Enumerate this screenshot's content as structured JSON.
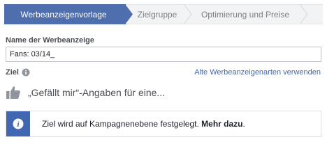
{
  "steps": [
    {
      "label": "Werbeanzeigenvorlage",
      "active": true
    },
    {
      "label": "Zielgruppe",
      "active": false
    },
    {
      "label": "Optimierung und Preise",
      "active": false
    },
    {
      "label": "",
      "active": false
    }
  ],
  "ad_name": {
    "label": "Name der Werbeanzeige",
    "value": "Fans: 03/14_"
  },
  "objective": {
    "label": "Ziel",
    "old_types_link": "Alte Werbeanzeigenarten verwenden",
    "selected": "„Gefällt mir“-Angaben für eine..."
  },
  "notice": {
    "text": "Ziel wird auf Kampagnenebene festgelegt. ",
    "more_link": "Mehr dazu",
    "suffix": "."
  },
  "colors": {
    "accent": "#4e6ead",
    "link": "#4267b2"
  },
  "icons": {
    "objective": "thumbs-up-icon",
    "info": "info-icon"
  }
}
